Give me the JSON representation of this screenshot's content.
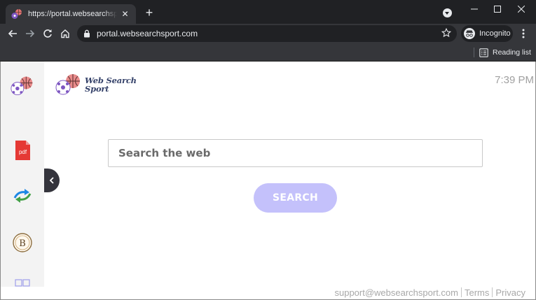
{
  "browser": {
    "tab_title": "https://portal.websearchsport.com",
    "tab_close": "✕",
    "new_tab": "+",
    "url": "portal.websearchsport.com",
    "incognito_label": "Incognito",
    "reading_list_label": "Reading list"
  },
  "page": {
    "brand_line1": "Web Search",
    "brand_line2": "Sport",
    "clock": "7:39 PM",
    "search": {
      "placeholder": "Search the web",
      "button_label": "SEARCH"
    },
    "footer": {
      "email": "support@websearchsport.com",
      "terms": "Terms",
      "privacy": "Privacy"
    }
  },
  "sidebar": {
    "pdf_label": "pdf",
    "coin_letter": "B"
  },
  "colors": {
    "chrome_dark": "#202124",
    "chrome_toolbar": "#35363a",
    "search_button": "#c4c1fb",
    "brand_text": "#35426a",
    "pdf_red": "#e53935"
  },
  "icons": [
    "sports-balls-icon",
    "pdf-icon",
    "arrows-icon",
    "bitcoin-coin-icon",
    "grid-icon",
    "chevron-left-icon",
    "lock-icon",
    "star-icon",
    "incognito-icon",
    "reading-list-icon",
    "back-arrow-icon",
    "forward-arrow-icon",
    "reload-icon",
    "home-icon"
  ]
}
